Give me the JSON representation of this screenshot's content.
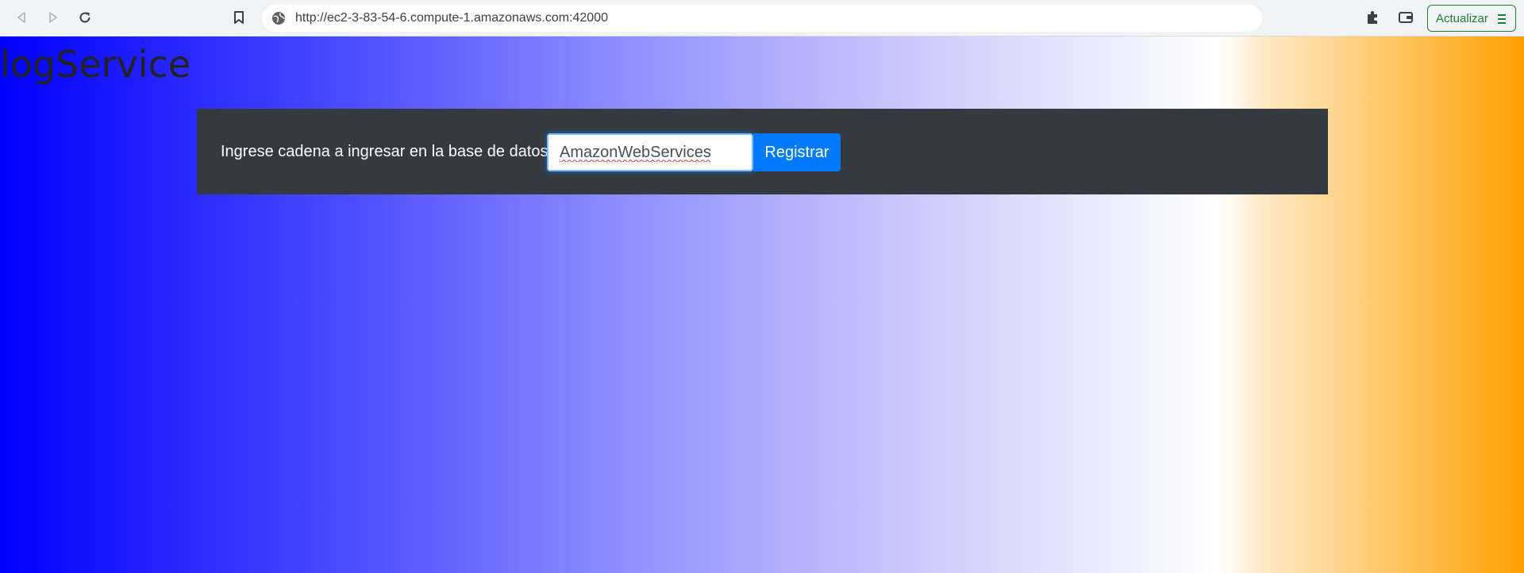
{
  "browser": {
    "url": "http://ec2-3-83-54-6.compute-1.amazonaws.com:42000",
    "update_label": "Actualizar",
    "icons": [
      "back-icon",
      "forward-icon",
      "reload-icon",
      "bookmark-icon",
      "globe-icon",
      "extensions-icon",
      "wallet-icon",
      "menu-icon"
    ]
  },
  "page": {
    "title": "logService",
    "form": {
      "label": "Ingrese cadena a ingresar en la base de datos :",
      "input_value": "AmazonWebServices",
      "button_label": "Registrar"
    }
  },
  "colors": {
    "gradient_start": "#0000ff",
    "gradient_mid": "#ffffff",
    "gradient_end": "#ffa000",
    "form_bar": "#343a40",
    "primary_button": "#007bff",
    "update_accent": "#188038"
  }
}
